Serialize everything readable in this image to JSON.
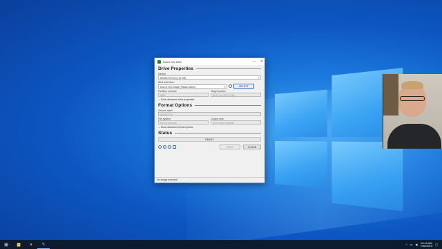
{
  "rufus": {
    "title": "Rufus 3.6.1551",
    "drive_properties": "Drive Properties",
    "device_label": "Device",
    "device_value": "KINGSTON (G:) [16 GB]",
    "boot_selection_label": "Boot selection",
    "boot_selection_value": "Disk or ISO image (Please select)",
    "select_button": "SELECT",
    "partition_scheme_label": "Partition scheme",
    "partition_scheme_value": "MBR",
    "target_system_label": "Target system",
    "target_system_value": "BIOS (or UEFI-CSM)",
    "show_adv_drive": "Show advanced drive properties",
    "format_options": "Format Options",
    "volume_label_label": "Volume label",
    "volume_label_value": "KINGSTON",
    "file_system_label": "File system",
    "file_system_value": "FAT32 (Default)",
    "cluster_size_label": "Cluster size",
    "cluster_size_value": "8192 bytes (Default)",
    "show_adv_format": "Show advanced format options",
    "status": "Status",
    "ready": "READY",
    "start_button": "START",
    "close_button": "CLOSE",
    "status_bar": "No image selected"
  },
  "taskbar": {
    "time": "10:43 AM",
    "date": "7/30/2019"
  },
  "icons": {
    "minimize": "minimize-icon",
    "close": "close-icon",
    "windows_start": "windows-icon"
  }
}
